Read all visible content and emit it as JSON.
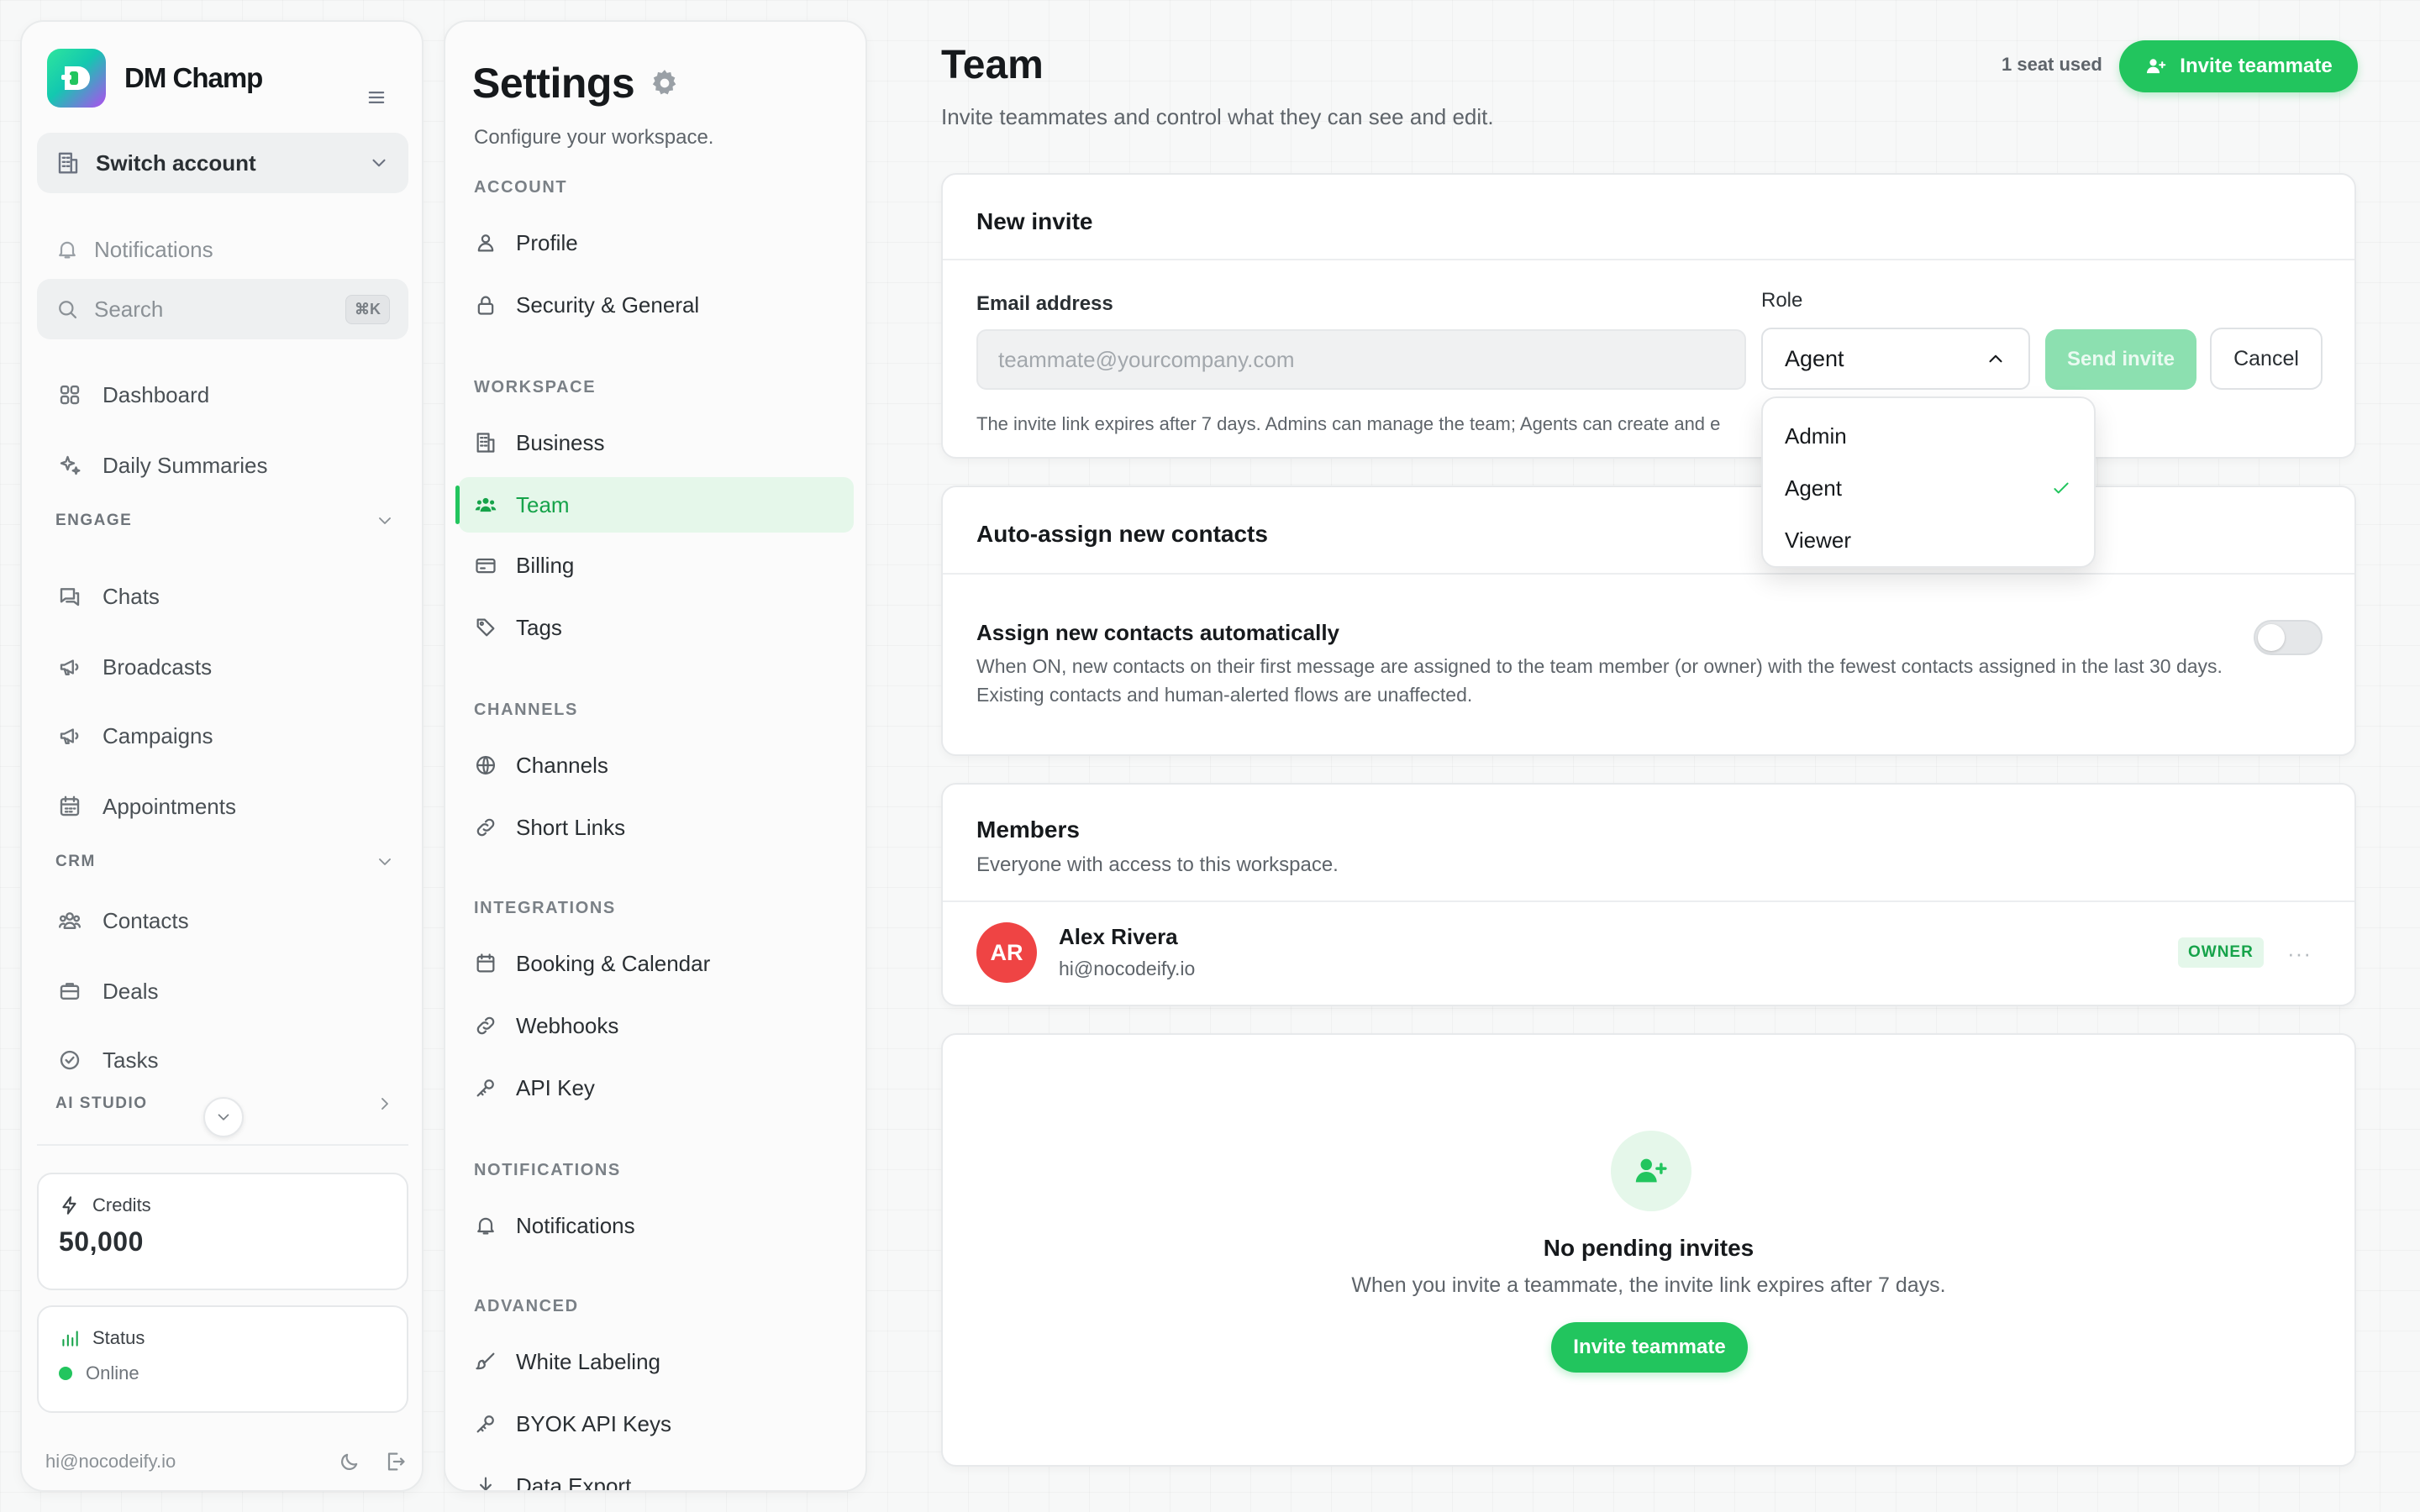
{
  "sidebar": {
    "brand_name": "DM Champ",
    "switch_account": "Switch account",
    "notifications": "Notifications",
    "search": {
      "label": "Search",
      "shortcut": "⌘K"
    },
    "items": [
      {
        "label": "Dashboard",
        "icon": "grid-icon"
      },
      {
        "label": "Daily Summaries",
        "icon": "sparkles-icon"
      }
    ],
    "sections": {
      "engage": "ENGAGE",
      "crm": "CRM",
      "ai_studio": "AI STUDIO"
    },
    "engage_items": [
      {
        "label": "Chats",
        "icon": "chat-icon"
      },
      {
        "label": "Broadcasts",
        "icon": "megaphone-icon"
      },
      {
        "label": "Campaigns",
        "icon": "megaphone-icon"
      },
      {
        "label": "Appointments",
        "icon": "calendar-icon"
      }
    ],
    "crm_items": [
      {
        "label": "Contacts",
        "icon": "users-icon"
      },
      {
        "label": "Deals",
        "icon": "briefcase-icon"
      },
      {
        "label": "Tasks",
        "icon": "check-circle-icon"
      }
    ],
    "credits": {
      "label": "Credits",
      "value": "50,000"
    },
    "status": {
      "label": "Status",
      "value": "Online"
    },
    "footer_email": "hi@nocodeify.io"
  },
  "settings": {
    "title": "Settings",
    "subtitle": "Configure your workspace.",
    "sections": {
      "account": "ACCOUNT",
      "workspace": "WORKSPACE",
      "channels": "CHANNELS",
      "integrations": "INTEGRATIONS",
      "notifications": "NOTIFICATIONS",
      "advanced": "ADVANCED"
    },
    "items": {
      "profile": "Profile",
      "security": "Security & General",
      "business": "Business",
      "team": "Team",
      "billing": "Billing",
      "tags": "Tags",
      "channels": "Channels",
      "short_links": "Short Links",
      "booking": "Booking & Calendar",
      "webhooks": "Webhooks",
      "api_key": "API Key",
      "notifications": "Notifications",
      "white_labeling": "White Labeling",
      "byok": "BYOK API Keys",
      "data_export": "Data Export"
    },
    "active_item": "Team"
  },
  "main": {
    "title": "Team",
    "subtitle": "Invite teammates and control what they can see and edit.",
    "seats": "1 seat used",
    "invite_button": "Invite teammate",
    "new_invite": {
      "title": "New invite",
      "email_label": "Email address",
      "email_placeholder": "teammate@yourcompany.com",
      "email_value": "",
      "role_label": "Role",
      "role_value": "Agent",
      "send_button": "Send invite",
      "cancel_button": "Cancel",
      "hint": "The invite link expires after 7 days. Admins can manage the team; Agents can create and e"
    },
    "role_options": [
      "Admin",
      "Agent",
      "Viewer"
    ],
    "role_selected": "Agent",
    "auto_assign": {
      "title": "Auto-assign new contacts",
      "label": "Assign new contacts automatically",
      "description": "When ON, new contacts on their first message are assigned to the team member (or owner) with the fewest contacts assigned in the last 30 days. Existing contacts and human-alerted flows are unaffected.",
      "enabled": false
    },
    "members": {
      "title": "Members",
      "subtitle": "Everyone with access to this workspace.",
      "list": [
        {
          "initials": "AR",
          "name": "Alex Rivera",
          "email": "hi@nocodeify.io",
          "role": "OWNER",
          "more": "···"
        }
      ]
    },
    "pending": {
      "title": "No pending invites",
      "subtitle": "When you invite a teammate, the invite link expires after 7 days.",
      "button": "Invite teammate"
    }
  },
  "colors": {
    "accent": "#22c55e",
    "accent_soft": "#e5f7ea",
    "avatar": "#ef4444"
  }
}
